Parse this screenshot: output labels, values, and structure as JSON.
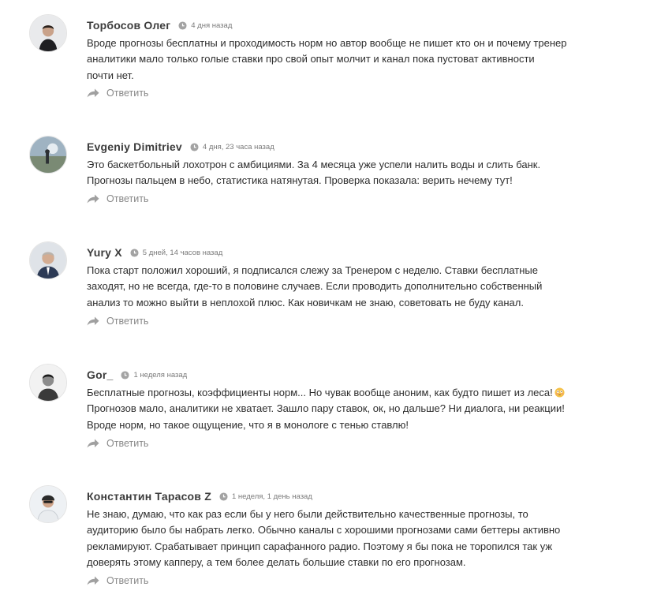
{
  "comments": [
    {
      "author": "Торбосов Олег",
      "time": "4 дня назад",
      "avatar_icon": "user-photo-icon",
      "lines": [
        "Вроде прогнозы бесплатны и проходимость норм но автор вообще не пишет кто он и почему тренер",
        "аналитики мало только голые ставки про свой опыт молчит и канал пока пустоват активности",
        "почти нет."
      ],
      "reply_label": "Ответить"
    },
    {
      "author": "Evgeniy Dimitriev",
      "time": "4 дня, 23 часа назад",
      "avatar_icon": "user-photo-icon",
      "lines": [
        "Это баскетбольный лохотрон с амбициями. За 4 месяца уже успели налить воды и слить банк.",
        "Прогнозы пальцем в небо, статистика натянутая. Проверка показала: верить нечему тут!"
      ],
      "reply_label": "Ответить"
    },
    {
      "author": "Yury X",
      "time": "5 дней, 14 часов назад",
      "avatar_icon": "user-photo-icon",
      "lines": [
        "Пока старт положил хороший, я подписался слежу за Тренером с неделю. Ставки бесплатные",
        "заходят, но не всегда, где-то в половине случаев. Если проводить дополнительно собственный",
        "анализ то можно выйти в неплохой плюс. Как новичкам не знаю, советовать не буду канал."
      ],
      "reply_label": "Ответить"
    },
    {
      "author": "Gor_",
      "time": "1 неделя назад",
      "avatar_icon": "user-photo-icon",
      "lines": [
        "Бесплатные прогнозы, коэффициенты норм... Но чувак вообще аноним, как будто пишет из леса!",
        "Прогнозов мало, аналитики не хватает. Зашло пару ставок, ок, но дальше? Ни диалога, ни реакции!",
        "Вроде норм, но такое ощущение, что я в монологе с тенью ставлю!"
      ],
      "emoji_icon": "flushed-face-emoji-icon",
      "reply_label": "Ответить"
    },
    {
      "author": "Константин Тарасов Z",
      "time": "1 неделя, 1 день назад",
      "avatar_icon": "user-photo-icon",
      "lines": [
        "Не знаю, думаю, что как раз если бы у него были действительно качественные прогнозы, то",
        "аудиторию было бы набрать легко. Обычно каналы с хорошими прогнозами сами беттеры активно",
        "рекламируют. Срабатывает принцип сарафанного радио. Поэтому я бы пока не торопился так уж",
        "доверять этому капперу, а тем более делать большие ставки по его прогнозам."
      ],
      "reply_label": "Ответить"
    }
  ],
  "icons": {
    "clock": "clock-icon",
    "reply": "reply-arrow-icon"
  },
  "colors": {
    "author": "#3c3c3c",
    "text": "#2d2d2d",
    "meta": "#7a7a7a",
    "reply": "#888888",
    "icon": "#9a9a9a"
  }
}
